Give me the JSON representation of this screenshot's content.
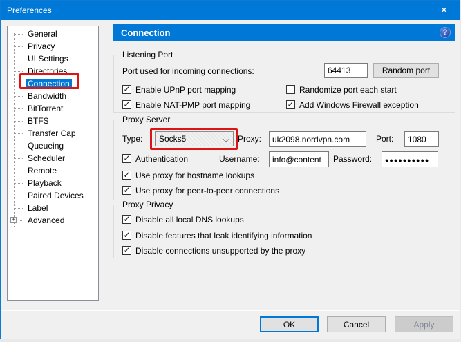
{
  "window": {
    "title": "Preferences"
  },
  "icons": {
    "close": "✕",
    "help": "?",
    "check": "✓",
    "chevron": "⌄",
    "expand": "+"
  },
  "colors": {
    "accent": "#0078d7",
    "annotation": "#dd1414"
  },
  "sidebar": {
    "items": [
      {
        "label": "General"
      },
      {
        "label": "Privacy"
      },
      {
        "label": "UI Settings"
      },
      {
        "label": "Directories"
      },
      {
        "label": "Connection",
        "selected": true
      },
      {
        "label": "Bandwidth"
      },
      {
        "label": "BitTorrent"
      },
      {
        "label": "BTFS"
      },
      {
        "label": "Transfer Cap"
      },
      {
        "label": "Queueing"
      },
      {
        "label": "Scheduler"
      },
      {
        "label": "Remote"
      },
      {
        "label": "Playback"
      },
      {
        "label": "Paired Devices"
      },
      {
        "label": "Label"
      },
      {
        "label": "Advanced",
        "expandable": true
      }
    ]
  },
  "header": {
    "title": "Connection"
  },
  "listening_port": {
    "title": "Listening Port",
    "port_label": "Port used for incoming connections:",
    "port_value": "64413",
    "random_port_button": "Random port",
    "checkboxes": [
      {
        "label": "Enable UPnP port mapping",
        "checked": true,
        "glyph": "✓"
      },
      {
        "label": "Randomize port each start",
        "checked": false,
        "glyph": ""
      },
      {
        "label": "Enable NAT-PMP port mapping",
        "checked": true,
        "glyph": "✓"
      },
      {
        "label": "Add Windows Firewall exception",
        "checked": true,
        "glyph": "✓"
      }
    ]
  },
  "proxy_server": {
    "title": "Proxy Server",
    "type_label": "Type:",
    "type_value": "Socks5",
    "proxy_label": "Proxy:",
    "proxy_value": "uk2098.nordvpn.com",
    "port_label": "Port:",
    "port_value": "1080",
    "auth": {
      "label": "Authentication",
      "checked": true,
      "glyph": "✓"
    },
    "username_label": "Username:",
    "username_value": "info@content",
    "password_label": "Password:",
    "password_value": "●●●●●●●●●●",
    "hostname": {
      "label": "Use proxy for hostname lookups",
      "checked": true,
      "glyph": "✓"
    },
    "p2p": {
      "label": "Use proxy for peer-to-peer connections",
      "checked": true,
      "glyph": "✓"
    }
  },
  "proxy_privacy": {
    "title": "Proxy Privacy",
    "checkboxes": [
      {
        "label": "Disable all local DNS lookups",
        "checked": true,
        "glyph": "✓"
      },
      {
        "label": "Disable features that leak identifying information",
        "checked": true,
        "glyph": "✓"
      },
      {
        "label": "Disable connections unsupported by the proxy",
        "checked": true,
        "glyph": "✓"
      }
    ]
  },
  "footer": {
    "ok": "OK",
    "cancel": "Cancel",
    "apply": "Apply"
  }
}
